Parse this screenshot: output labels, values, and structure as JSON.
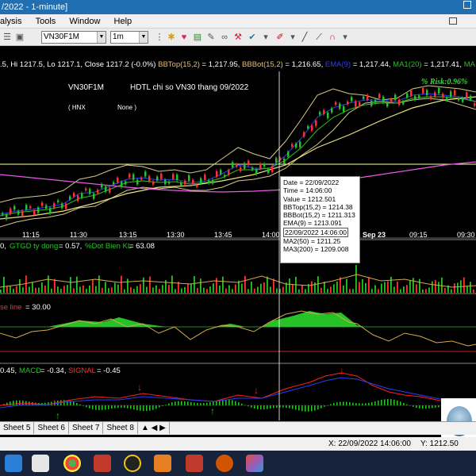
{
  "window": {
    "title": "/2022 - 1-minute]"
  },
  "menu": [
    "alysis",
    "Tools",
    "Window",
    "Help"
  ],
  "toolbar": {
    "symbol": "VN30F1M",
    "interval": "1m"
  },
  "info": {
    "ohlc": ".5, Hi 1217.5, Lo 1217.1, Close 1217.2 (-0.0%)",
    "bbtop": "BBTop(15,2)",
    "bbtop_val": " = 1,217.95, ",
    "bbbot": "BBBot(15,2)",
    "bbbot_val": " = 1,216.65, ",
    "ema_label": "EMA(9)",
    "ema_val": " = 1,217.44, ",
    "ma1": "MA1(20)",
    "ma1_val": " = 1,217.41, ",
    "ma2_tail": "MA"
  },
  "chart": {
    "symbol_label": "VN30F1M",
    "subtitle": "HDTL chi so VN30 thang 09/2022",
    "exchange": "( HNX",
    "none": "None )",
    "risk": "% Risk:0.96%",
    "time_ticks": [
      "11:15",
      "11:30",
      "13:15",
      "13:30",
      "13:45",
      "14:00",
      "Sep 23",
      "09:15",
      "09:30"
    ],
    "panel2": {
      "prefix": "0, ",
      "label": "GTGD ty dong",
      "val": " = 0.57, ",
      "label2": "%Dot Bien KL",
      "val2": " = 63.08"
    },
    "panel3": {
      "label": "se line",
      "val": " = 30.00"
    },
    "panel4": {
      "prefix": "0.45, ",
      "label": "MACD",
      "val": " = -0.34, ",
      "label2": "SIGNAL",
      "val2": " = -0.45"
    }
  },
  "tooltip": [
    "Date = 22/09/2022",
    "Time = 14:06:00",
    "Value = 1212.501",
    "BBTop(15,2) = 1214.38",
    "BBBot(15,2) = 1211.313",
    "EMA(9) = 1213.091",
    "22/09/2022 14:06:00",
    "MA2(50) = 1211.25",
    "MA3(200) = 1209.008"
  ],
  "tabs": [
    "Sheet 5",
    "Sheet 6",
    "Sheet 7",
    "Sheet 8"
  ],
  "status": {
    "x": "X: 22/09/2022 14:06:00",
    "y": "Y: 1212.50"
  },
  "colors": {
    "bb": "#d8c98a",
    "ema": "#2a3cff",
    "ma1": "#27c227",
    "ma3": "#e85ae8",
    "macd": "#ff2020",
    "signal": "#2a3cff"
  }
}
